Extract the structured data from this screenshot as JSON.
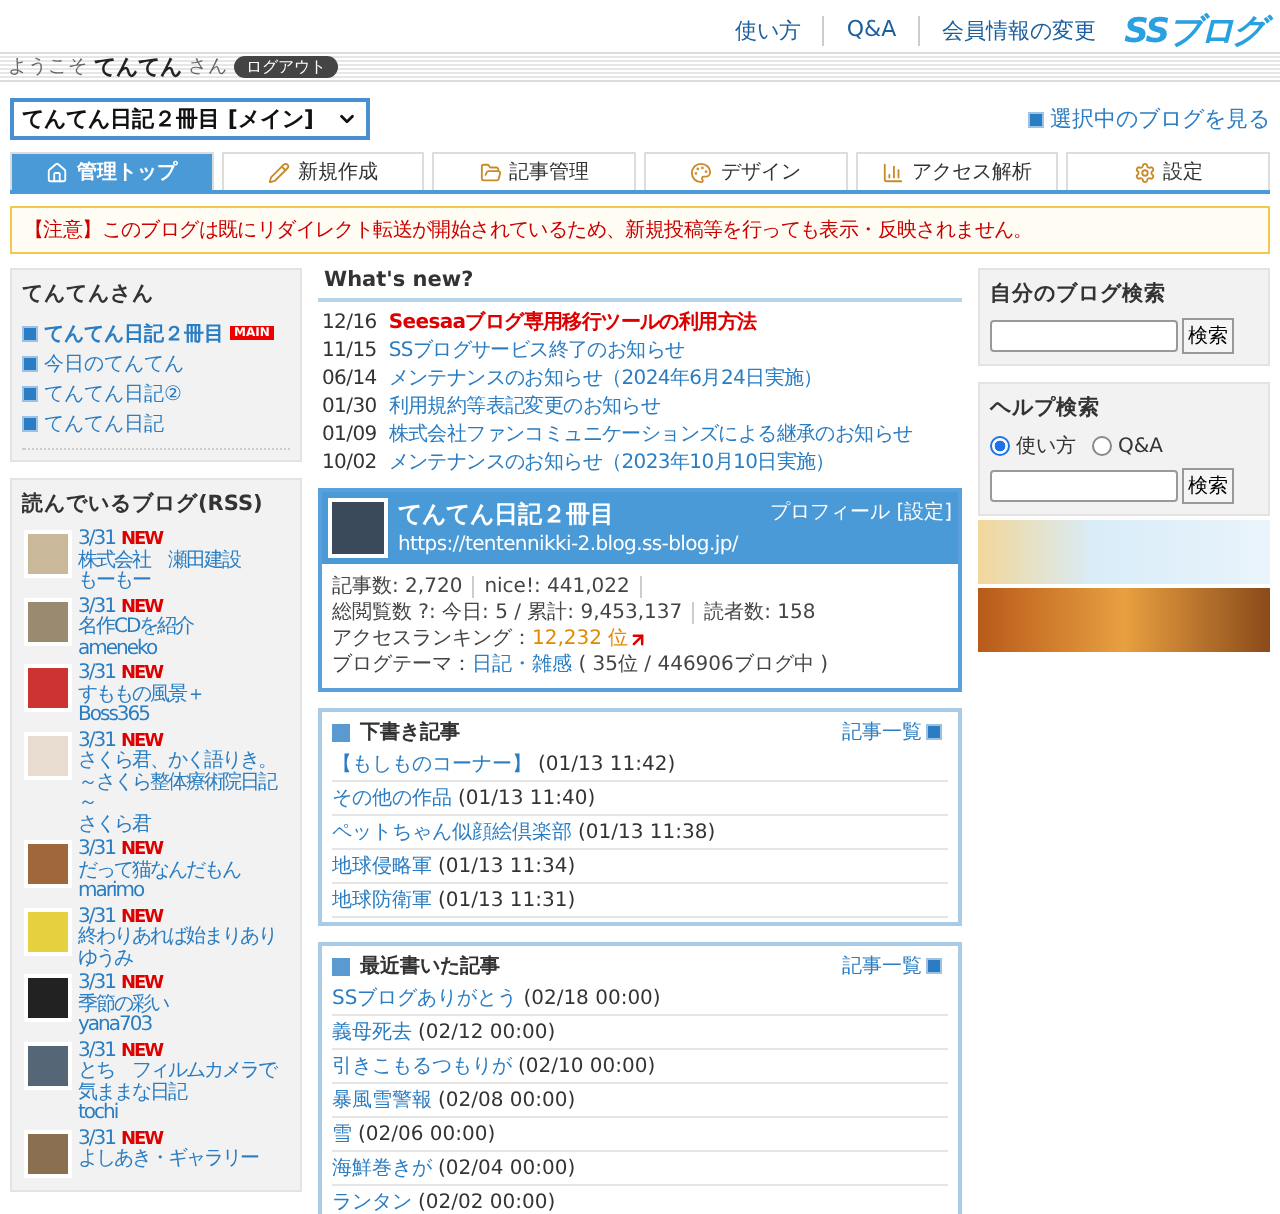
{
  "header": {
    "links": [
      "使い方",
      "Q&A",
      "会員情報の変更"
    ],
    "logo": "SSブログ"
  },
  "welcome": {
    "prefix": "ようこそ",
    "name": "てんてん",
    "suffix": "さん",
    "logout": "ログアウト"
  },
  "blog_select": {
    "value": "てんてん日記２冊目 [メイン]"
  },
  "view_blog_link": "選択中のブログを見る",
  "tabs": [
    {
      "label": "管理トップ",
      "selected": true
    },
    {
      "label": "新規作成",
      "selected": false
    },
    {
      "label": "記事管理",
      "selected": false
    },
    {
      "label": "デザイン",
      "selected": false
    },
    {
      "label": "アクセス解析",
      "selected": false
    },
    {
      "label": "設定",
      "selected": false
    }
  ],
  "notice": "【注意】このブログは既にリダイレクト転送が開始されているため、新規投稿等を行っても表示・反映されません。",
  "my_blogs": {
    "title": "てんてんさん",
    "items": [
      {
        "label": "てんてん日記２冊目",
        "badge": "MAIN",
        "selected": true
      },
      {
        "label": "今日のてんてん",
        "selected": false
      },
      {
        "label": "てんてん日記②",
        "selected": false
      },
      {
        "label": "てんてん日記",
        "selected": false
      }
    ]
  },
  "rss": {
    "title": "読んでいるブログ(RSS)",
    "items": [
      {
        "date": "3/31",
        "new": "NEW",
        "title": "株式会社　瀬田建設",
        "author": "もーもー"
      },
      {
        "date": "3/31",
        "new": "NEW",
        "title": "名作CDを紹介",
        "author": "ameneko"
      },
      {
        "date": "3/31",
        "new": "NEW",
        "title": "すももの風景＋",
        "author": "Boss365"
      },
      {
        "date": "3/31",
        "new": "NEW",
        "title": "さくら君、かく語りき。～さくら整体療術院日記～",
        "author": "さくら君"
      },
      {
        "date": "3/31",
        "new": "NEW",
        "title": "だって猫なんだもん",
        "author": "marimo"
      },
      {
        "date": "3/31",
        "new": "NEW",
        "title": "終わりあれば始まりあり",
        "author": "ゆうみ"
      },
      {
        "date": "3/31",
        "new": "NEW",
        "title": "季節の彩い",
        "author": "yana703"
      },
      {
        "date": "3/31",
        "new": "NEW",
        "title": "とち　フィルムカメラで気ままな日記",
        "author": "tochi"
      },
      {
        "date": "3/31",
        "new": "NEW",
        "title": "よしあき・ギャラリー"
      }
    ]
  },
  "whats_new": {
    "title": "What's new?",
    "items": [
      {
        "date": "12/16",
        "text": "Seesaaブログ専用移行ツールの利用方法",
        "important": true
      },
      {
        "date": "11/15",
        "text": "SSブログサービス終了のお知らせ",
        "important": false
      },
      {
        "date": "06/14",
        "text": "メンテナンスのお知らせ（2024年6月24日実施）",
        "important": false
      },
      {
        "date": "01/30",
        "text": "利用規約等表記変更のお知らせ",
        "important": false
      },
      {
        "date": "01/09",
        "text": "株式会社ファンコミュニケーションズによる継承のお知らせ",
        "important": false
      },
      {
        "date": "10/02",
        "text": "メンテナンスのお知らせ（2023年10月10日実施）",
        "important": false
      }
    ]
  },
  "blog_card": {
    "title": "てんてん日記２冊目",
    "url": "https://tentennikki-2.blog.ss-blog.jp/",
    "profile_link": "プロフィール",
    "settings_link": "[設定]",
    "stats": [
      "記事数: 2,720",
      "nice!: 441,022",
      "総閲覧数 ?: 今日: 5 / 累計: 9,453,137",
      "読者数: 158"
    ],
    "ranking_label": "アクセスランキング：",
    "ranking_value": "12,232 位",
    "theme_label": "ブログテーマ：",
    "theme_link": "日記・雑感",
    "theme_rank": "( 35位 / 446906ブログ中 )"
  },
  "panels": [
    {
      "title": "下書き記事",
      "list_link": "記事一覧",
      "items": [
        {
          "title": "【もしものコーナー】",
          "time": "(01/13 11:42)"
        },
        {
          "title": "その他の作品",
          "time": "(01/13 11:40)"
        },
        {
          "title": "ペットちゃん似顔絵倶楽部",
          "time": "(01/13 11:38)"
        },
        {
          "title": "地球侵略軍",
          "time": "(01/13 11:34)"
        },
        {
          "title": "地球防衛軍",
          "time": "(01/13 11:31)"
        }
      ]
    },
    {
      "title": "最近書いた記事",
      "list_link": "記事一覧",
      "items": [
        {
          "title": "SSブログありがとう",
          "time": "(02/18 00:00)"
        },
        {
          "title": "義母死去",
          "time": "(02/12 00:00)"
        },
        {
          "title": "引きこもるつもりが",
          "time": "(02/10 00:00)"
        },
        {
          "title": "暴風雪警報",
          "time": "(02/08 00:00)"
        },
        {
          "title": "雪",
          "time": "(02/06 00:00)"
        },
        {
          "title": "海鮮巻きが",
          "time": "(02/04 00:00)"
        },
        {
          "title": "ランタン",
          "time": "(02/02 00:00)"
        }
      ]
    }
  ],
  "own_search": {
    "title": "自分のブログ検索",
    "button": "検索"
  },
  "help_search": {
    "title": "ヘルプ検索",
    "options": [
      {
        "label": "使い方",
        "selected": true
      },
      {
        "label": "Q&A",
        "selected": false
      }
    ],
    "button": "検索"
  }
}
